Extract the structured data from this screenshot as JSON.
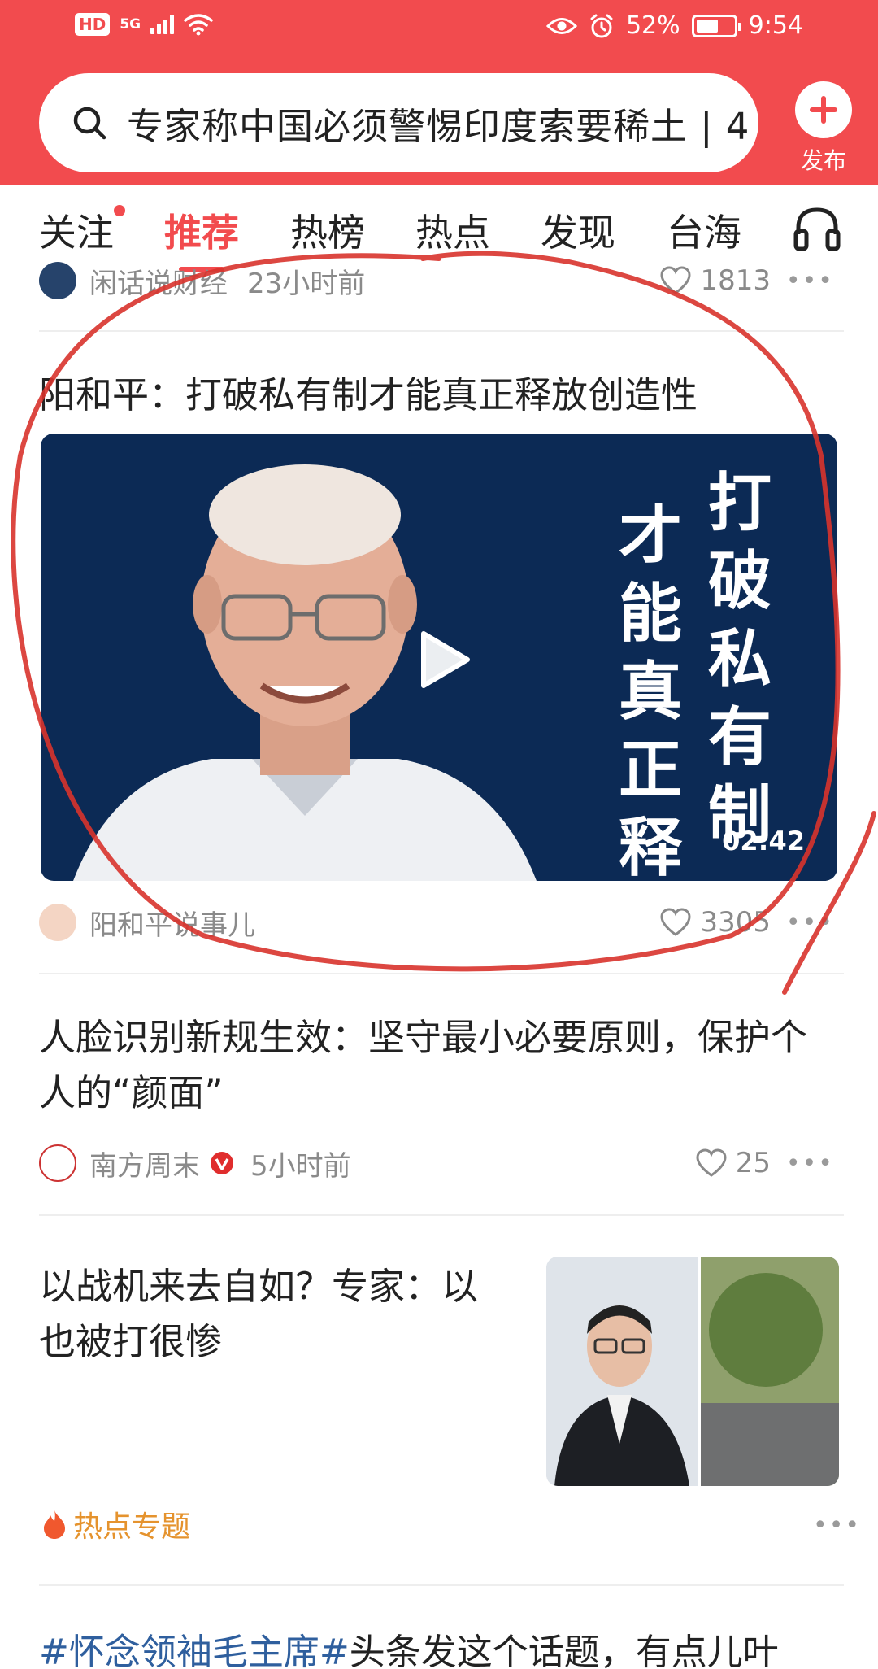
{
  "status_bar": {
    "hd": "HD",
    "network": "5G",
    "battery": "52%",
    "time": "9:54"
  },
  "search": {
    "text": "专家称中国必须警惕印度索要稀土 | 4"
  },
  "publish": {
    "label": "发布"
  },
  "tabs": [
    {
      "label": "关注",
      "has_dot": true
    },
    {
      "label": "推荐",
      "active": true
    },
    {
      "label": "热榜"
    },
    {
      "label": "热点"
    },
    {
      "label": "发现"
    },
    {
      "label": "台海"
    }
  ],
  "feed": {
    "partial_item": {
      "source": "闲话说财经",
      "time": "23小时前",
      "likes": "1813"
    },
    "video_item": {
      "title": "阳和平：打破私有制才能真正释放创造性",
      "overlay_col1": "打破私有制",
      "overlay_col2": "才能真正释放",
      "duration": "02:42",
      "source": "阳和平说事儿",
      "likes": "3305"
    },
    "article_item": {
      "title": "人脸识别新规生效：坚守最小必要原则，保护个人的“颜面”",
      "source": "南方周末",
      "time": "5小时前",
      "likes": "25"
    },
    "image_item": {
      "title": "以战机来去自如？专家：以也被打很惨",
      "hot_topic": "热点专题"
    },
    "hashtag_item": {
      "tag": "#怀念领袖毛主席#",
      "text": "头条发这个话题，有点儿叶"
    }
  },
  "colors": {
    "brand_red": "#f24b4e",
    "video_bg": "#0c2a55",
    "hot_orange": "#e5932e",
    "hashtag_blue": "#2f5f9e"
  }
}
